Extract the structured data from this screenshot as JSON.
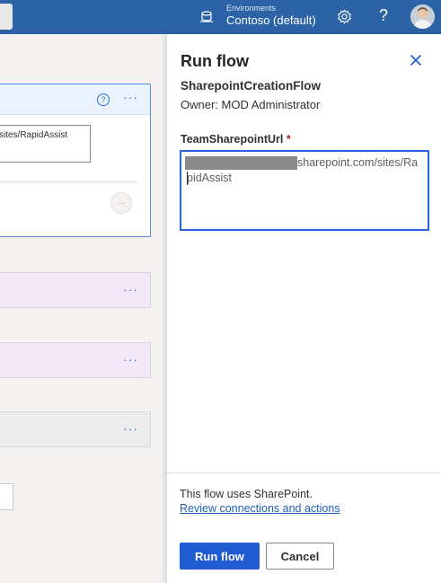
{
  "topbar": {
    "environment_label": "Environments",
    "environment_value": "Contoso (default)",
    "help_glyph": "?",
    "icons": [
      "environment-icon",
      "gear-icon",
      "help-icon",
      "avatar"
    ]
  },
  "canvas": {
    "active_card": {
      "input_value": "sites/RapidAssist",
      "info_glyph": "?",
      "more_glyph": "···",
      "circle_glyph": "···"
    },
    "step_more_glyph": "···"
  },
  "panel": {
    "title": "Run flow",
    "flow_name": "SharepointCreationFlow",
    "owner": "Owner: MOD Administrator",
    "field_label": "TeamSharepointUrl",
    "required_mark": "*",
    "field_value_line1": "sharepoint.com/sites/Ra",
    "field_value_line2": "pidAssist",
    "uses_text": "This flow uses SharePoint.",
    "review_link": "Review connections and actions",
    "run_button": "Run flow",
    "cancel_button": "Cancel"
  },
  "colors": {
    "topbar": "#2b63a6",
    "accent": "#1f5bd1",
    "step_purple": "#f2e8f7",
    "step_grey": "#ececec"
  }
}
